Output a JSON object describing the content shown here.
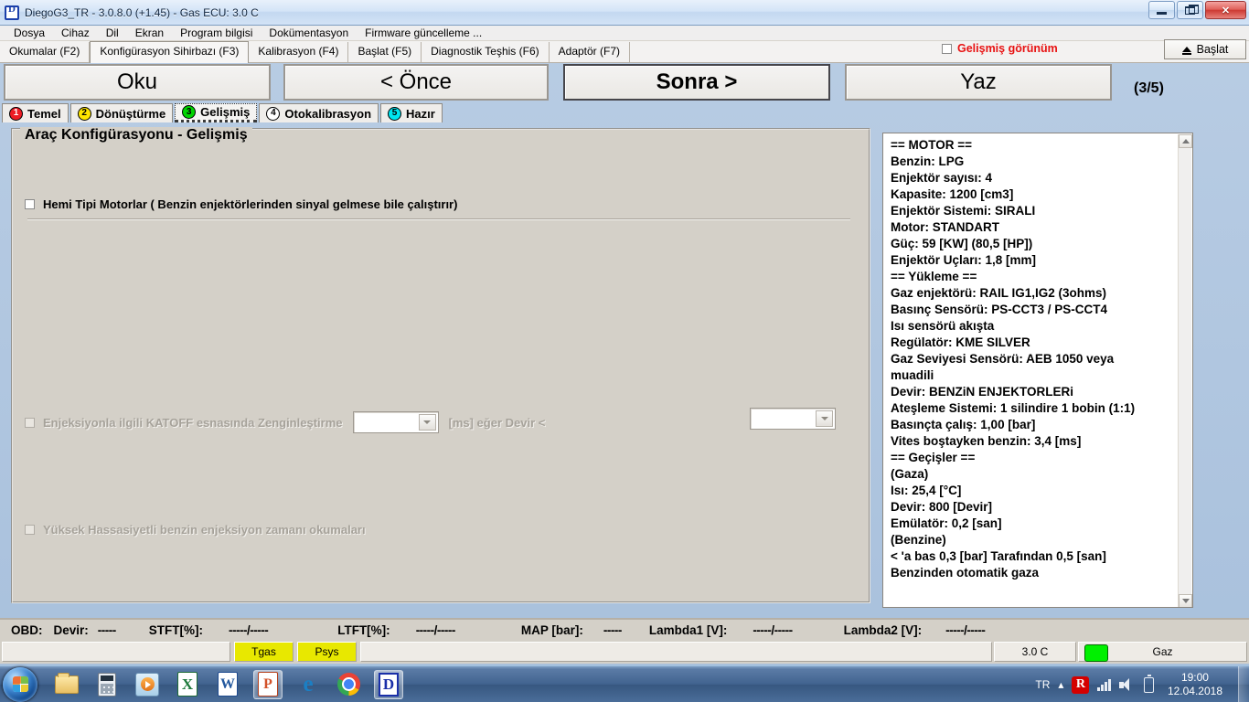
{
  "window": {
    "title": "DiegoG3_TR - 3.0.8.0 (+1.45) - Gas ECU: 3.0 C",
    "app_icon": "diego-app-icon",
    "minimize": "minimize-icon",
    "maximize": "maximize-icon",
    "close": "close-icon"
  },
  "menu": {
    "items": [
      {
        "label": "Dosya"
      },
      {
        "label": "Cihaz"
      },
      {
        "label": "Dil"
      },
      {
        "label": "Ekran"
      },
      {
        "label": "Program bilgisi"
      },
      {
        "label": "Dokümentasyon"
      },
      {
        "label": "Firmware güncelleme ..."
      }
    ]
  },
  "ftabs": {
    "items": [
      {
        "label": "Okumalar (F2)",
        "selected": false
      },
      {
        "label": "Konfigürasyon Sihirbazı (F3)",
        "selected": true
      },
      {
        "label": "Kalibrasyon (F4)",
        "selected": false
      },
      {
        "label": "Başlat (F5)",
        "selected": false
      },
      {
        "label": "Diagnostik Teşhis (F6)",
        "selected": false
      },
      {
        "label": "Adaptör (F7)",
        "selected": false
      }
    ],
    "advanced_view_label": "Gelişmiş görünüm",
    "advanced_view_checked": false,
    "advanced_view_color": "#e81212",
    "start_button_label": "Başlat"
  },
  "nav": {
    "read_label": "Oku",
    "prev_label": "< Önce",
    "next_label": "Sonra >",
    "write_label": "Yaz",
    "page_counter": "(3/5)"
  },
  "steptabs": {
    "items": [
      {
        "num": "1",
        "label": "Temel",
        "color": "#ed1c24",
        "selected": false
      },
      {
        "num": "2",
        "label": "Dönüştürme",
        "color": "#ffe600",
        "selected": false
      },
      {
        "num": "3",
        "label": "Gelişmiş",
        "color": "#00d400",
        "selected": true
      },
      {
        "num": "4",
        "label": "Otokalibrasyon",
        "color": "#ffffff",
        "selected": false
      },
      {
        "num": "5",
        "label": "Hazır",
        "color": "#00e5f0",
        "selected": false
      }
    ]
  },
  "groupbox": {
    "title": "Araç Konfigürasyonu - Gelişmiş",
    "hemi_checkbox_label": "Hemi Tipi Motorlar ( Benzin enjektörlerinden sinyal gelmese bile çalıştırır)",
    "hemi_checked": false,
    "katoff_checkbox_label": "Enjeksiyonla ilgili KATOFF esnasında Zenginleştirme",
    "katoff_checked": false,
    "katoff_mid_label": "[ms] eğer Devir <",
    "katoff_combo1_value": "",
    "katoff_combo2_value": "",
    "highprec_checkbox_label": "Yüksek Hassasiyetli benzin enjeksiyon zamanı okumaları",
    "highprec_checked": false
  },
  "info_panel": {
    "lines": [
      "== MOTOR ==",
      "Benzin: LPG",
      "Enjektör sayısı: 4",
      "Kapasite: 1200 [cm3]",
      "Enjektör Sistemi: SIRALI",
      "Motor: STANDART",
      "Güç: 59 [KW] (80,5 [HP])",
      "Enjektör Uçları: 1,8 [mm]",
      "== Yükleme ==",
      "Gaz enjektörü: RAIL IG1,IG2 (3ohms)",
      "Basınç Sensörü: PS-CCT3 / PS-CCT4",
      "Isı sensörü akışta",
      "Regülatör: KME SILVER",
      "Gaz Seviyesi Sensörü: AEB 1050 veya",
      "muadili",
      "Devir: BENZiN ENJEKTORLERi",
      "Ateşleme Sistemi: 1 silindire 1 bobin (1:1)",
      "Basınçta çalış: 1,00 [bar]",
      "Vites boştayken benzin: 3,4 [ms]",
      "== Geçişler ==",
      "(Gaza)",
      "Isı: 25,4 [°C]",
      "Devir: 800 [Devir]",
      "Emülatör: 0,2 [san]",
      "(Benzine)",
      "< 'a bas 0,3 [bar] Tarafından 0,5 [san]",
      "Benzinden otomatik gaza"
    ]
  },
  "obd_bar": {
    "obd_label": "OBD:",
    "rpm_label": "Devir:",
    "rpm_value": "-----",
    "stft_label": "STFT[%]:",
    "stft_value": "-----/-----",
    "ltft_label": "LTFT[%]:",
    "ltft_value": "-----/-----",
    "map_label": "MAP [bar]:",
    "map_value": "-----",
    "lambda1_label": "Lambda1 [V]:",
    "lambda1_value": "-----/-----",
    "lambda2_label": "Lambda2 [V]:",
    "lambda2_value": "-----/-----"
  },
  "status_bar": {
    "left_value": "",
    "tgas_label": "Tgas",
    "psys_label": "Psys",
    "mid_value": "",
    "temp_value": "3.0 C",
    "led_color": "#00f000",
    "fuel_mode": "Gaz"
  },
  "taskbar": {
    "start_orb": "windows-start-orb",
    "items": [
      {
        "name": "explorer",
        "icon": "folder-icon",
        "active": false
      },
      {
        "name": "calculator",
        "icon": "calculator-icon",
        "active": false
      },
      {
        "name": "media-player",
        "icon": "media-player-icon",
        "active": false
      },
      {
        "name": "excel",
        "icon": "excel-icon",
        "glyph": "X",
        "active": false
      },
      {
        "name": "word",
        "icon": "word-icon",
        "glyph": "W",
        "active": false
      },
      {
        "name": "powerpoint",
        "icon": "powerpoint-icon",
        "glyph": "P",
        "active": true
      },
      {
        "name": "internet-explorer",
        "icon": "internet-explorer-icon",
        "glyph": "e",
        "active": false
      },
      {
        "name": "chrome",
        "icon": "chrome-icon",
        "active": false
      },
      {
        "name": "diego",
        "icon": "diego-icon",
        "glyph": "D",
        "active": true
      }
    ],
    "tray": {
      "lang": "TR",
      "show_hidden": "chevron-up-icon",
      "antivirus": "avira-icon",
      "antivirus_glyph": "R",
      "network": "signal-bars-icon",
      "volume": "speaker-icon",
      "battery": "battery-icon",
      "time": "19:00",
      "date": "12.04.2018"
    }
  }
}
